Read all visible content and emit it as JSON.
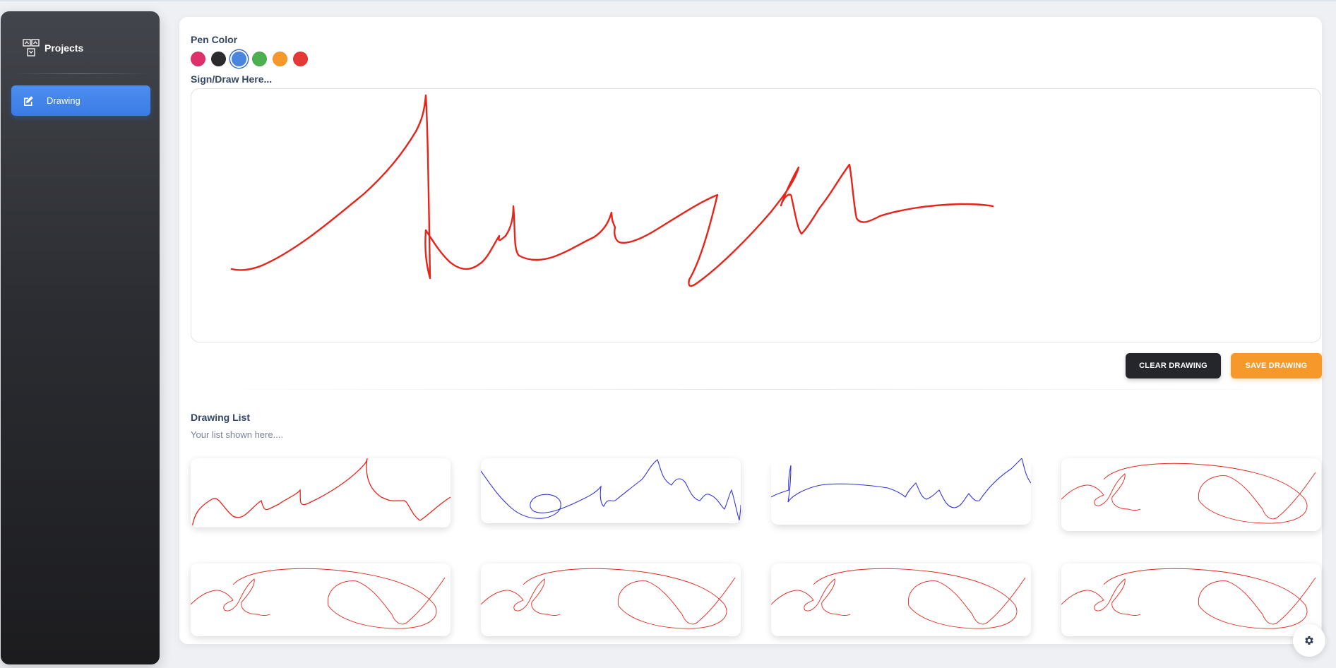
{
  "sidebar": {
    "brand": {
      "name": "Projects",
      "icon": "app-grid-icon"
    },
    "nav": [
      {
        "label": "Drawing",
        "icon": "pen-edit-icon",
        "active": true
      }
    ]
  },
  "pen_color": {
    "label": "Pen Color",
    "colors": [
      "#e0306c",
      "#2b2b2e",
      "#4a86e0",
      "#4caf50",
      "#f7982a",
      "#e53935"
    ],
    "selected": "#4a86e0"
  },
  "canvas": {
    "label": "Sign/Draw Here...",
    "stroke_color": "#e8231a"
  },
  "actions": {
    "clear_label": "CLEAR DRAWING",
    "save_label": "SAVE DRAWING"
  },
  "drawing_list": {
    "title": "Drawing List",
    "subtitle": "Your list shown here....",
    "items": [
      {
        "color": "#e8231a"
      },
      {
        "color": "#3434e0"
      },
      {
        "color": "#3434e0"
      },
      {
        "color": "#e8231a"
      },
      {
        "color": "#e8231a"
      },
      {
        "color": "#e8231a"
      },
      {
        "color": "#e8231a"
      },
      {
        "color": "#e8231a"
      }
    ]
  },
  "settings": {
    "icon": "gear-icon"
  }
}
